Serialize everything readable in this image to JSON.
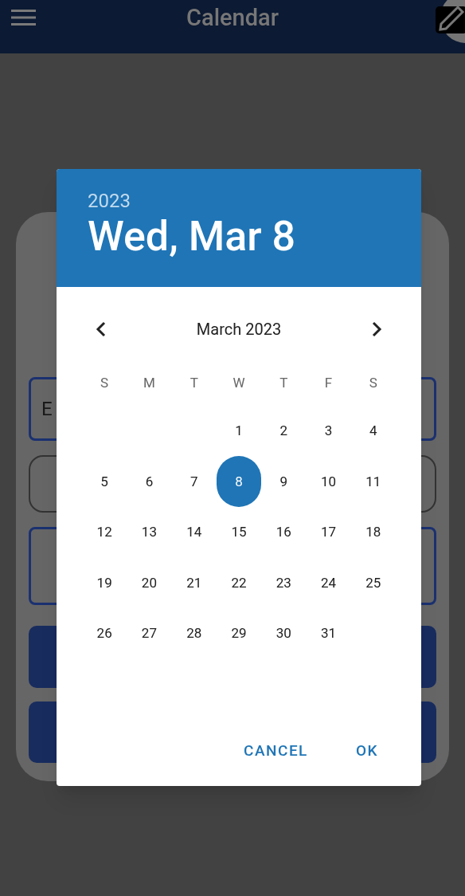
{
  "app_bar": {
    "title": "Calendar"
  },
  "form": {
    "title_field": {
      "value": "E"
    }
  },
  "date_picker": {
    "year": "2023",
    "date": "Wed, Mar 8",
    "month": "March 2023",
    "weekdays": [
      "S",
      "M",
      "T",
      "W",
      "T",
      "F",
      "S"
    ],
    "weeks": [
      [
        {
          "label": "1",
          "selected": false
        },
        {
          "label": "2",
          "selected": false
        },
        {
          "label": "3",
          "selected": false
        },
        {
          "label": "4",
          "selected": false
        }
      ],
      [
        {
          "label": "5",
          "selected": false
        },
        {
          "label": "6",
          "selected": false
        },
        {
          "label": "7",
          "selected": false
        },
        {
          "label": "8",
          "selected": true
        },
        {
          "label": "9",
          "selected": false
        },
        {
          "label": "10",
          "selected": false
        },
        {
          "label": "11",
          "selected": false
        }
      ],
      [
        {
          "label": "12",
          "selected": false
        },
        {
          "label": "13",
          "selected": false
        },
        {
          "label": "14",
          "selected": false
        },
        {
          "label": "15",
          "selected": false
        },
        {
          "label": "16",
          "selected": false
        },
        {
          "label": "17",
          "selected": false
        },
        {
          "label": "18",
          "selected": false
        }
      ],
      [
        {
          "label": "19",
          "selected": false
        },
        {
          "label": "20",
          "selected": false
        },
        {
          "label": "21",
          "selected": false
        },
        {
          "label": "22",
          "selected": false
        },
        {
          "label": "23",
          "selected": false
        },
        {
          "label": "24",
          "selected": false
        },
        {
          "label": "25",
          "selected": false
        }
      ],
      [
        {
          "label": "26",
          "selected": false
        },
        {
          "label": "27",
          "selected": false
        },
        {
          "label": "28",
          "selected": false
        },
        {
          "label": "29",
          "selected": false
        },
        {
          "label": "30",
          "selected": false
        },
        {
          "label": "31",
          "selected": false
        }
      ]
    ],
    "buttons": [
      "CANCEL",
      "OK"
    ]
  }
}
